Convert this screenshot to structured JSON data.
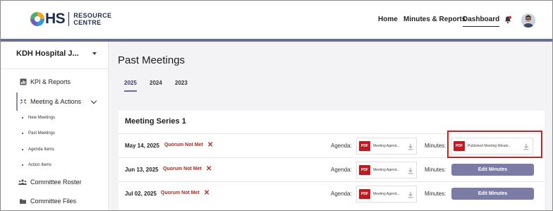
{
  "header": {
    "logo": {
      "main": "HS",
      "sub_line1": "RESOURCE",
      "sub_line2": "CENTRE"
    },
    "nav": {
      "home": "Home",
      "minutes_reports": "Minutes & Reports",
      "dashboard": "Dashboard"
    },
    "icons": {
      "bell": "bell-icon",
      "avatar": "user-avatar"
    }
  },
  "sidebar": {
    "site": "KDH Hospital J...",
    "items": [
      {
        "label": "KPI & Reports",
        "icon": "chart-icon"
      },
      {
        "label": "Meeting & Actions",
        "icon": "meeting-icon"
      },
      {
        "label": "Committee Roster",
        "icon": "people-icon"
      },
      {
        "label": "Committee Files",
        "icon": "folder-icon"
      }
    ],
    "sub_items": [
      "New Meetings",
      "Past Meetings",
      "Agenda Items",
      "Action Items"
    ]
  },
  "main": {
    "title": "Past Meetings",
    "tabs": [
      "2025",
      "2024",
      "2023"
    ],
    "active_tab": "2025",
    "series": {
      "title": "Meeting Series 1",
      "agenda_label": "Agenda:",
      "minutes_label": "Minutes:",
      "rows": [
        {
          "date": "May 14, 2025",
          "status": "Quorum Not Met",
          "agenda_file": "Meeting Agend...",
          "minutes_file": "Published Meeting Minute...",
          "minutes_action": ""
        },
        {
          "date": "Jun 13, 2025",
          "status": "Quorum Not Met",
          "agenda_file": "Meeting Agend...",
          "minutes_file": "",
          "minutes_action": "Edit Minutes"
        },
        {
          "date": "Jul 02, 2025",
          "status": "Quorum Not Met",
          "agenda_file": "Meeting Agend...",
          "minutes_file": "",
          "minutes_action": "Edit Minutes"
        }
      ]
    },
    "pdf_badge": "PDF"
  },
  "colors": {
    "accent": "#6b6b9c",
    "danger": "#c62828",
    "pdf": "#c0191f",
    "button": "#7b7ba6"
  }
}
